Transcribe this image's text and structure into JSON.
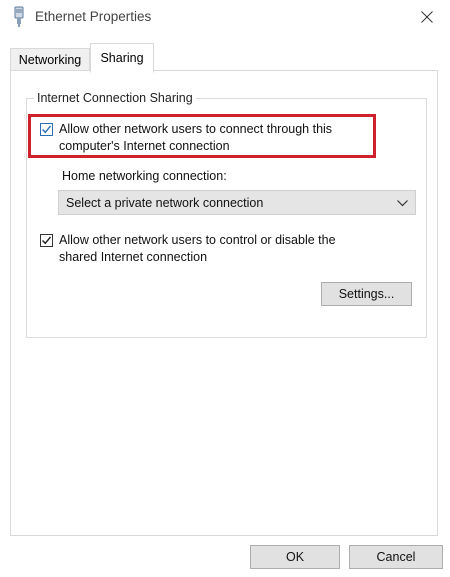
{
  "window": {
    "title": "Ethernet Properties",
    "icon": "ethernet-adapter-icon",
    "close_icon": "close-icon"
  },
  "tabs": [
    {
      "label": "Networking",
      "selected": false
    },
    {
      "label": "Sharing",
      "selected": true
    }
  ],
  "sharing": {
    "group_title": "Internet Connection Sharing",
    "allow_connect": {
      "checked": true,
      "label_line1": "Allow other network users to connect through this",
      "label_line2": "computer's Internet connection"
    },
    "home_connection": {
      "label": "Home networking connection:",
      "selected": "Select a private network connection"
    },
    "allow_control": {
      "checked": true,
      "label_line1": "Allow other network users to control or disable the",
      "label_line2": "shared Internet connection"
    },
    "settings_button": "Settings..."
  },
  "footer": {
    "ok_button": "OK",
    "cancel_button": "Cancel"
  },
  "colors": {
    "highlight": "#d0202e",
    "checkbox_accent": "#2a6fb4"
  }
}
